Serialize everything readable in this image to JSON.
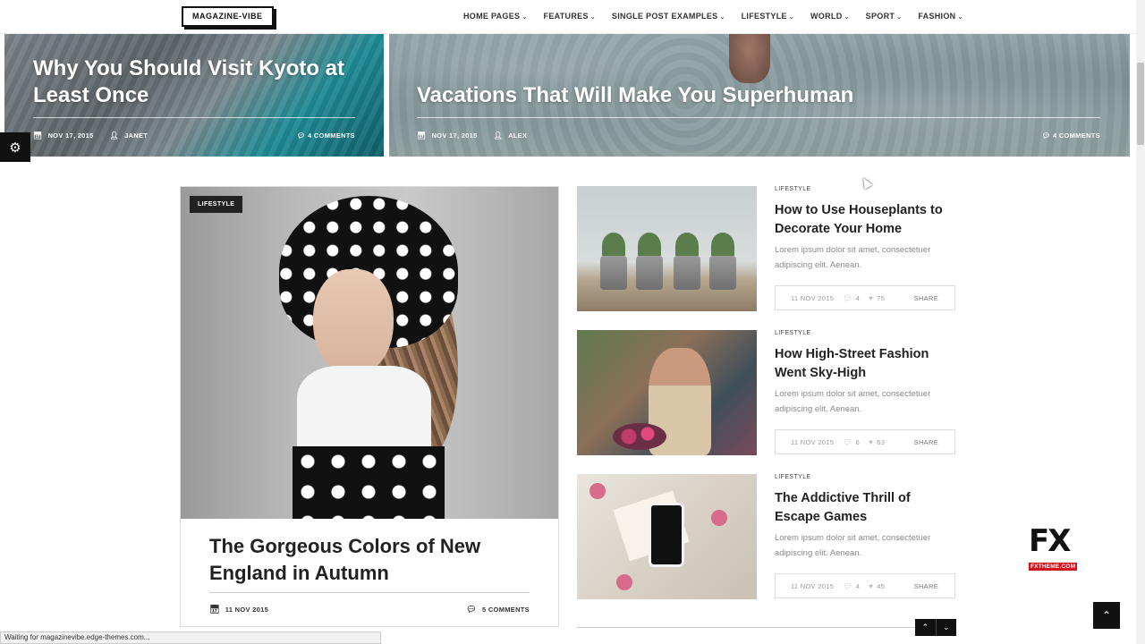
{
  "header": {
    "logo": "MAGAZINE-VIBE",
    "nav": [
      "HOME PAGES",
      "FEATURES",
      "SINGLE POST EXAMPLES",
      "LIFESTYLE",
      "WORLD",
      "SPORT",
      "FASHION"
    ]
  },
  "hero": [
    {
      "title": "Why You Should Visit Kyoto at Least Once",
      "date": "NOV 17, 2015",
      "author": "JANET",
      "comments": "4 COMMENTS"
    },
    {
      "title": "Vacations That Will Make You Superhuman",
      "date": "NOV 17, 2015",
      "author": "ALEX",
      "comments": "4 COMMENTS"
    }
  ],
  "featured": {
    "category": "LIFESTYLE",
    "title": "The Gorgeous Colors of New England in Autumn",
    "date": "11 NOV 2015",
    "comments": "5 COMMENTS"
  },
  "posts": [
    {
      "category": "LIFESTYLE",
      "title": "How to Use Houseplants to Decorate Your Home",
      "excerpt": "Lorem ipsum dolor sit amet, consectetuer adipiscing elit. Aenean.",
      "date": "11 NOV 2015",
      "comments": "4",
      "likes": "75",
      "share": "SHARE"
    },
    {
      "category": "LIFESTYLE",
      "title": "How High-Street Fashion Went Sky-High",
      "excerpt": "Lorem ipsum dolor sit amet, consectetuer adipiscing elit. Aenean.",
      "date": "11 NOV 2015",
      "comments": "6",
      "likes": "63",
      "share": "SHARE"
    },
    {
      "category": "LIFESTYLE",
      "title": "The Addictive Thrill of Escape Games",
      "excerpt": "Lorem ipsum dolor sit amet, consectetuer adipiscing elit. Aenean.",
      "date": "11 NOV 2015",
      "comments": "4",
      "likes": "45",
      "share": "SHARE"
    }
  ],
  "watermark": {
    "big": "FX",
    "small": "FXTHEME.COM"
  },
  "status_bar": "Waiting for magazinevibe.edge-themes.com...",
  "icons": {
    "calendar": "calendar-icon",
    "user": "user-icon",
    "comment": "comment-icon",
    "heart": "heart-icon",
    "gear": "gear-icon",
    "up": "chevron-up-icon",
    "down": "chevron-down-icon"
  },
  "colors": {
    "accent": "#111111",
    "muted": "#8a8a8a",
    "watermark_red": "#d4141c"
  }
}
